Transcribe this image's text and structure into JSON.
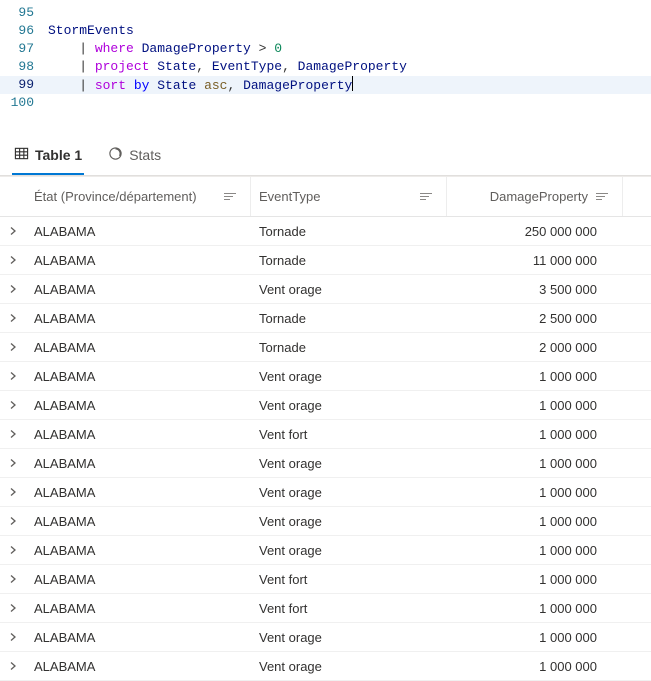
{
  "editor": {
    "lines": [
      {
        "num": "95",
        "tokens": []
      },
      {
        "num": "96",
        "tokens": [
          {
            "t": "StormEvents",
            "c": "tok-ident"
          }
        ]
      },
      {
        "num": "97",
        "tokens": [
          {
            "t": "    | ",
            "c": "tok-punc"
          },
          {
            "t": "where",
            "c": "tok-op"
          },
          {
            "t": " DamageProperty ",
            "c": "tok-ident"
          },
          {
            "t": "> ",
            "c": "tok-plain"
          },
          {
            "t": "0",
            "c": "tok-num"
          }
        ]
      },
      {
        "num": "98",
        "tokens": [
          {
            "t": "    | ",
            "c": "tok-punc"
          },
          {
            "t": "project",
            "c": "tok-op"
          },
          {
            "t": " State",
            "c": "tok-ident"
          },
          {
            "t": ", ",
            "c": "tok-plain"
          },
          {
            "t": "EventType",
            "c": "tok-ident"
          },
          {
            "t": ", ",
            "c": "tok-plain"
          },
          {
            "t": "DamageProperty",
            "c": "tok-ident"
          }
        ]
      },
      {
        "num": "99",
        "highlight": true,
        "cursor": true,
        "tokens": [
          {
            "t": "    | ",
            "c": "tok-punc"
          },
          {
            "t": "sort",
            "c": "tok-op"
          },
          {
            "t": " ",
            "c": "tok-plain"
          },
          {
            "t": "by",
            "c": "tok-by"
          },
          {
            "t": " State ",
            "c": "tok-ident"
          },
          {
            "t": "asc",
            "c": "tok-func"
          },
          {
            "t": ", ",
            "c": "tok-plain"
          },
          {
            "t": "DamageProperty",
            "c": "tok-ident"
          }
        ]
      },
      {
        "num": "100",
        "tokens": []
      }
    ]
  },
  "tabs": {
    "table_label": "Table 1",
    "stats_label": "Stats"
  },
  "table": {
    "headers": {
      "state": "État (Province/département)",
      "event": "EventType",
      "damage": "DamageProperty"
    },
    "rows": [
      {
        "state": "ALABAMA",
        "event": "Tornade",
        "damage": "250 000 000"
      },
      {
        "state": "ALABAMA",
        "event": "Tornade",
        "damage": "11 000 000"
      },
      {
        "state": "ALABAMA",
        "event": "Vent orage",
        "damage": "3 500 000"
      },
      {
        "state": "ALABAMA",
        "event": "Tornade",
        "damage": "2 500 000"
      },
      {
        "state": "ALABAMA",
        "event": "Tornade",
        "damage": "2 000 000"
      },
      {
        "state": "ALABAMA",
        "event": "Vent orage",
        "damage": "1 000 000"
      },
      {
        "state": "ALABAMA",
        "event": "Vent orage",
        "damage": "1 000 000"
      },
      {
        "state": "ALABAMA",
        "event": "Vent fort",
        "damage": "1 000 000"
      },
      {
        "state": "ALABAMA",
        "event": "Vent orage",
        "damage": "1 000 000"
      },
      {
        "state": "ALABAMA",
        "event": "Vent orage",
        "damage": "1 000 000"
      },
      {
        "state": "ALABAMA",
        "event": "Vent orage",
        "damage": "1 000 000"
      },
      {
        "state": "ALABAMA",
        "event": "Vent orage",
        "damage": "1 000 000"
      },
      {
        "state": "ALABAMA",
        "event": "Vent fort",
        "damage": "1 000 000"
      },
      {
        "state": "ALABAMA",
        "event": "Vent fort",
        "damage": "1 000 000"
      },
      {
        "state": "ALABAMA",
        "event": "Vent orage",
        "damage": "1 000 000"
      },
      {
        "state": "ALABAMA",
        "event": "Vent orage",
        "damage": "1 000 000"
      }
    ]
  }
}
